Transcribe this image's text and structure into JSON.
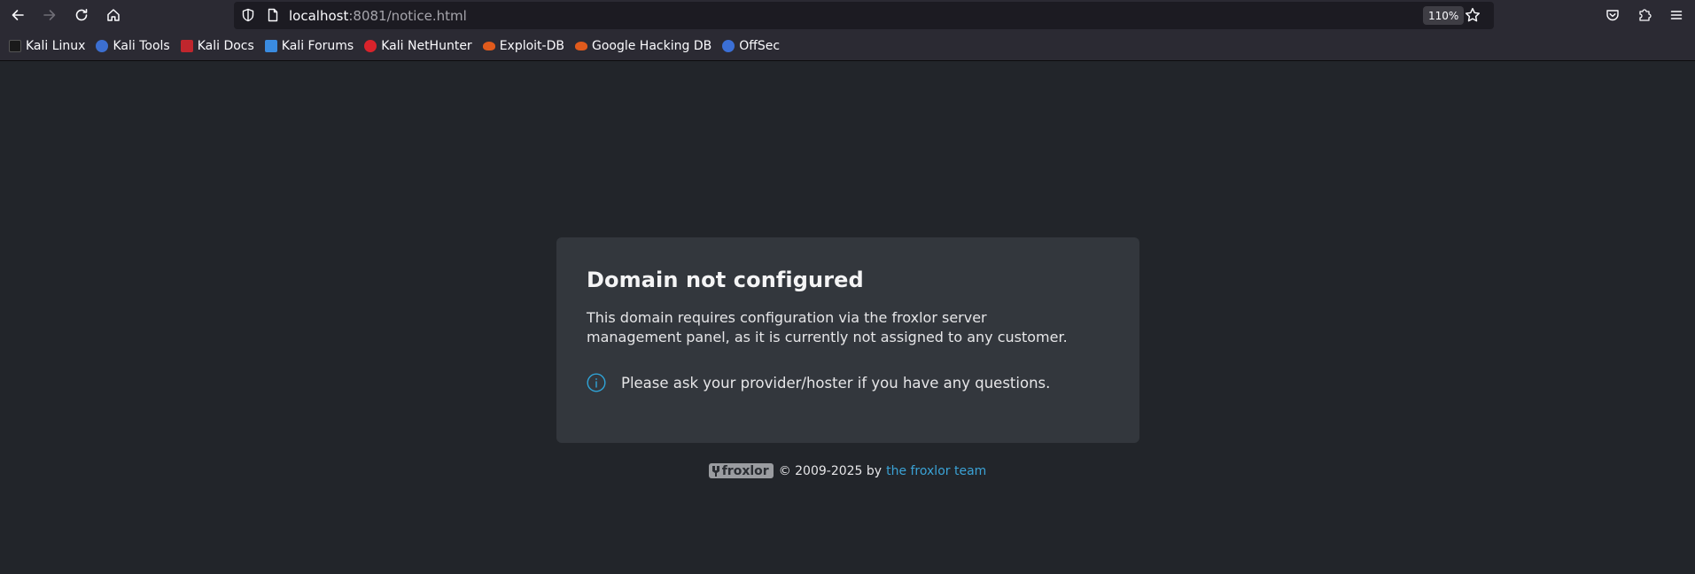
{
  "browser": {
    "url_host": "localhost",
    "url_rest": ":8081/notice.html",
    "zoom": "110%"
  },
  "bookmarks": [
    {
      "label": "Kali Linux",
      "icon": "kali-linux-icon",
      "color": "#1a1a1a"
    },
    {
      "label": "Kali Tools",
      "icon": "kali-tools-icon",
      "color": "#3c6fd1"
    },
    {
      "label": "Kali Docs",
      "icon": "kali-docs-icon",
      "color": "#c0262d"
    },
    {
      "label": "Kali Forums",
      "icon": "kali-forums-icon",
      "color": "#3a8be0"
    },
    {
      "label": "Kali NetHunter",
      "icon": "kali-nethunter-icon",
      "color": "#d9232b"
    },
    {
      "label": "Exploit-DB",
      "icon": "exploit-db-icon",
      "color": "#e05a1c"
    },
    {
      "label": "Google Hacking DB",
      "icon": "ghdb-icon",
      "color": "#e05a1c"
    },
    {
      "label": "OffSec",
      "icon": "offsec-icon",
      "color": "#3b6fd6"
    }
  ],
  "notice": {
    "title": "Domain not configured",
    "body": "This domain requires configuration via the froxlor server management panel, as it is currently not assigned to any customer.",
    "info": "Please ask your provider/hoster if you have any questions."
  },
  "footer": {
    "logo_text": "froxlor",
    "copyright": "© 2009-2025 by",
    "link_text": "the froxlor team"
  },
  "colors": {
    "accent": "#2fa4d8",
    "page_bg": "#22252a",
    "card_bg": "#33373d"
  }
}
